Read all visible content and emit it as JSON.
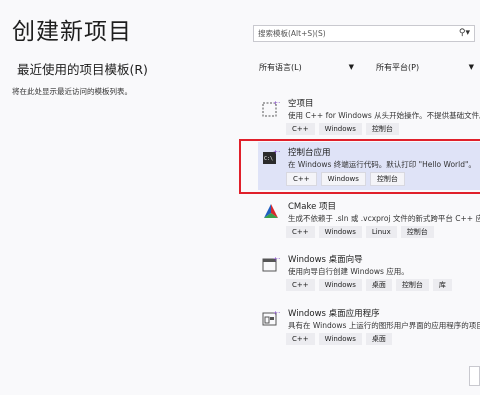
{
  "header": {
    "title": "创建新项目",
    "recent_title": "最近使用的项目模板(R)",
    "recent_hint": "将在此处显示最近访问的模板列表。"
  },
  "search": {
    "placeholder": "搜索模板(Alt+S)(S)"
  },
  "filters": {
    "language": "所有语言(L)",
    "platform": "所有平台(P)"
  },
  "templates": [
    {
      "name": "空项目",
      "desc": "使用 C++ for Windows 从头开始操作。不提供基础文件。",
      "tags": [
        "C++",
        "Windows",
        "控制台"
      ]
    },
    {
      "name": "控制台应用",
      "desc": "在 Windows 终端运行代码。默认打印 \"Hello World\"。",
      "tags": [
        "C++",
        "Windows",
        "控制台"
      ]
    },
    {
      "name": "CMake 项目",
      "desc": "生成不依赖于 .sln 或 .vcxproj 文件的新式跨平台 C++ 应用",
      "tags": [
        "C++",
        "Windows",
        "Linux",
        "控制台"
      ]
    },
    {
      "name": "Windows 桌面向导",
      "desc": "使用向导自行创建 Windows 应用。",
      "tags": [
        "C++",
        "Windows",
        "桌面",
        "控制台",
        "库"
      ]
    },
    {
      "name": "Windows 桌面应用程序",
      "desc": "具有在 Windows 上运行的图形用户界面的应用程序的项目",
      "tags": [
        "C++",
        "Windows",
        "桌面"
      ]
    }
  ],
  "selected_index": 1,
  "colors": {
    "selected_bg": "#dfe3f7",
    "highlight_border": "#e0202a"
  }
}
